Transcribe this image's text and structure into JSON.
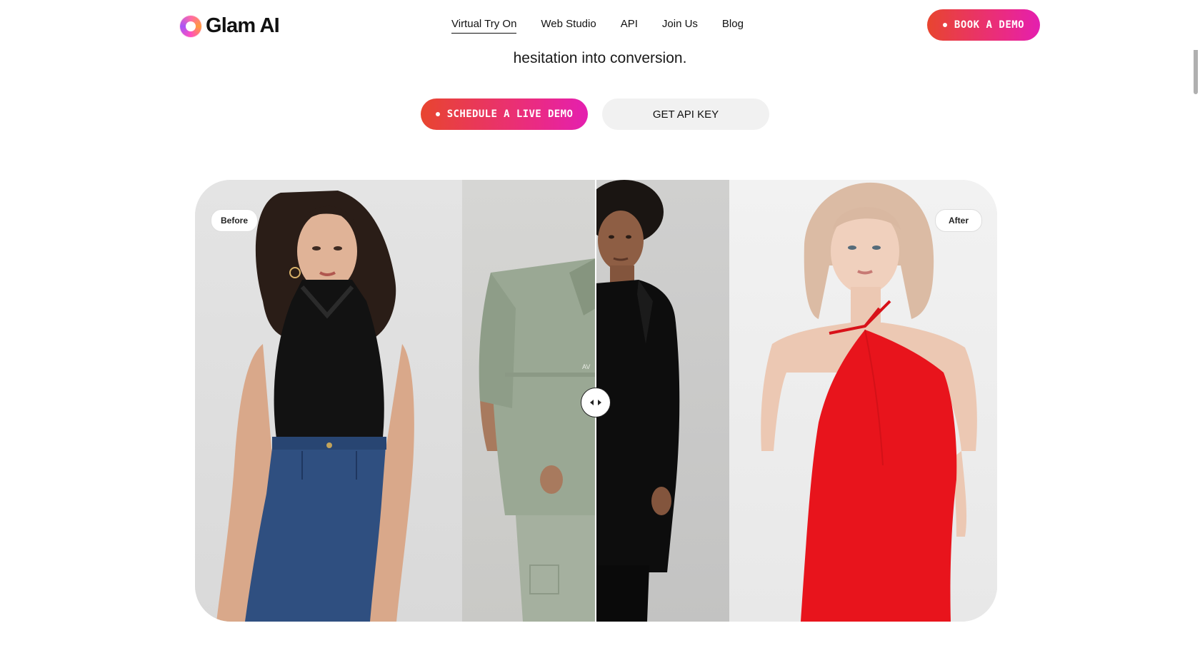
{
  "brand": {
    "name": "Glam AI"
  },
  "nav": {
    "items": [
      {
        "label": "Virtual Try On",
        "active": true
      },
      {
        "label": "Web Studio"
      },
      {
        "label": "API"
      },
      {
        "label": "Join Us"
      },
      {
        "label": "Blog"
      }
    ],
    "cta_label": "BOOK A DEMO"
  },
  "hero": {
    "line2": "hesitation into conversion."
  },
  "actions": {
    "primary_label": "SCHEDULE A LIVE DEMO",
    "secondary_label": "GET API KEY"
  },
  "comparison": {
    "before_label": "Before",
    "after_label": "After"
  },
  "colors": {
    "accent_start": "#e8452f",
    "accent_end": "#e41fb0",
    "dress_red": "#e8141c"
  },
  "icons": {
    "handle": "arrows-left-right-icon",
    "logo": "ring-logo-icon"
  }
}
